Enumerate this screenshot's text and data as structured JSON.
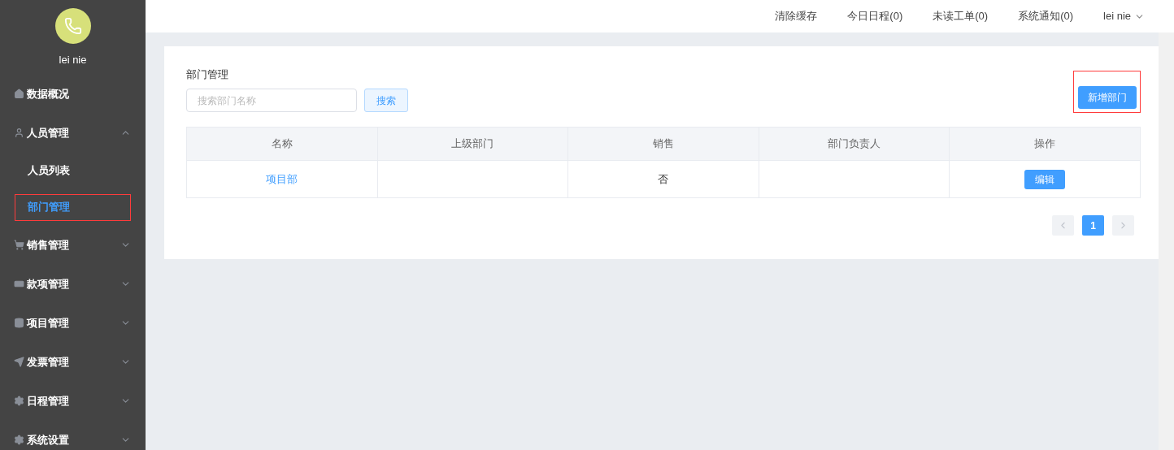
{
  "sidebar": {
    "user": {
      "name": "lei nie"
    },
    "items": [
      {
        "kind": "link",
        "label": "数据概况"
      },
      {
        "kind": "group",
        "label": "人员管理",
        "expanded": true,
        "children": [
          {
            "label": "人员列表",
            "selected": false,
            "highlighted": false
          },
          {
            "label": "部门管理",
            "selected": true,
            "highlighted": true
          }
        ]
      },
      {
        "kind": "group",
        "label": "销售管理",
        "expanded": false
      },
      {
        "kind": "group",
        "label": "款项管理",
        "expanded": false
      },
      {
        "kind": "group",
        "label": "项目管理",
        "expanded": false
      },
      {
        "kind": "group",
        "label": "发票管理",
        "expanded": false
      },
      {
        "kind": "group",
        "label": "日程管理",
        "expanded": false
      },
      {
        "kind": "group",
        "label": "系统设置",
        "expanded": false
      }
    ]
  },
  "top_bar": {
    "links": [
      "清除缓存",
      "今日日程(0)",
      "未读工单(0)",
      "系统通知(0)"
    ],
    "user": "lei nie"
  },
  "panel": {
    "title": "部门管理",
    "search": {
      "placeholder": "搜索部门名称"
    },
    "search_button": "搜索",
    "add_button": {
      "label": "新增部门",
      "highlighted": true
    },
    "table": {
      "columns": [
        "名称",
        "上级部门",
        "销售",
        "部门负责人",
        "操作"
      ],
      "rows": [
        {
          "name": "项目部",
          "sales": "否",
          "action": "编辑"
        }
      ]
    },
    "pagination": {
      "pages": [
        {
          "label": "1",
          "selected": true
        }
      ]
    }
  }
}
